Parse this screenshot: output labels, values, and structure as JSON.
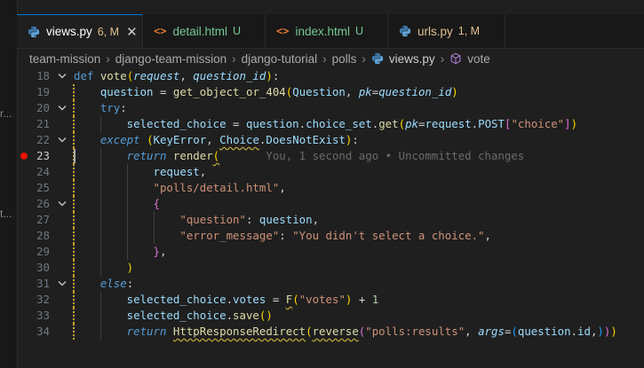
{
  "sidebar_fragments": [
    "r...",
    "t..."
  ],
  "tabs": [
    {
      "name": "views.py",
      "status": "6, M",
      "icon": "python-icon",
      "active": true,
      "status_color": "#e2c08d"
    },
    {
      "name": "detail.html",
      "status": "U",
      "icon": "html-icon",
      "active": false,
      "status_color": "#73c991"
    },
    {
      "name": "index.html",
      "status": "U",
      "icon": "html-icon",
      "active": false,
      "status_color": "#73c991"
    },
    {
      "name": "urls.py",
      "status": "1, M",
      "icon": "python-icon",
      "active": false,
      "status_color": "#e2c08d"
    }
  ],
  "tab_close_glyph": "✕",
  "breadcrumb": {
    "items": [
      "team-mission",
      "django-team-mission",
      "django-tutorial",
      "polls",
      "views.py",
      "vote"
    ],
    "separator": "›"
  },
  "editor": {
    "current_line": 23,
    "blame_text": "You, 1 second ago • Uncommitted changes",
    "line_numbers": [
      "18",
      "19",
      "20",
      "21",
      "22",
      "23",
      "24",
      "25",
      "26",
      "27",
      "28",
      "29",
      "30",
      "31",
      "32",
      "33",
      "34"
    ],
    "lines": [
      [
        {
          "t": "def ",
          "c": "kw"
        },
        {
          "t": "vote",
          "c": "fn"
        },
        {
          "t": "(",
          "c": "br1"
        },
        {
          "t": "request",
          "c": "vi"
        },
        {
          "t": ", ",
          "c": "pu"
        },
        {
          "t": "question_id",
          "c": "vi"
        },
        {
          "t": ")",
          "c": "br1"
        },
        {
          "t": ":",
          "c": "pu"
        }
      ],
      [
        {
          "t": "    question",
          "c": "va"
        },
        {
          "t": " = ",
          "c": "pu"
        },
        {
          "t": "get_object_or_404",
          "c": "fn"
        },
        {
          "t": "(",
          "c": "br1"
        },
        {
          "t": "Question",
          "c": "va"
        },
        {
          "t": ", ",
          "c": "pu"
        },
        {
          "t": "pk",
          "c": "vi"
        },
        {
          "t": "=",
          "c": "pu"
        },
        {
          "t": "question_id",
          "c": "vi"
        },
        {
          "t": ")",
          "c": "br1"
        }
      ],
      [
        {
          "t": "    try",
          "c": "kw"
        },
        {
          "t": ":",
          "c": "pu"
        }
      ],
      [
        {
          "t": "        selected_choice",
          "c": "va"
        },
        {
          "t": " = ",
          "c": "pu"
        },
        {
          "t": "question",
          "c": "va"
        },
        {
          "t": ".",
          "c": "pu"
        },
        {
          "t": "choice_set",
          "c": "va"
        },
        {
          "t": ".",
          "c": "pu"
        },
        {
          "t": "get",
          "c": "fn"
        },
        {
          "t": "(",
          "c": "br1"
        },
        {
          "t": "pk",
          "c": "vi"
        },
        {
          "t": "=",
          "c": "pu"
        },
        {
          "t": "request",
          "c": "va"
        },
        {
          "t": ".",
          "c": "pu"
        },
        {
          "t": "POST",
          "c": "va"
        },
        {
          "t": "[",
          "c": "br2"
        },
        {
          "t": "\"choice\"",
          "c": "st"
        },
        {
          "t": "]",
          "c": "br2"
        },
        {
          "t": ")",
          "c": "br1"
        }
      ],
      [
        {
          "t": "    except",
          "c": "kw-i"
        },
        {
          "t": " ",
          "c": "pu"
        },
        {
          "t": "(",
          "c": "br1"
        },
        {
          "t": "KeyError",
          "c": "va"
        },
        {
          "t": ", ",
          "c": "pu"
        },
        {
          "t": "Choice",
          "c": "va squig"
        },
        {
          "t": ".",
          "c": "pu"
        },
        {
          "t": "DoesNotExist",
          "c": "va"
        },
        {
          "t": ")",
          "c": "br1"
        },
        {
          "t": ":",
          "c": "pu"
        }
      ],
      [
        {
          "t": "        return",
          "c": "kw-i"
        },
        {
          "t": " ",
          "c": "pu"
        },
        {
          "t": "render",
          "c": "fn"
        },
        {
          "t": "(",
          "c": "br1 squig"
        }
      ],
      [
        {
          "t": "            request",
          "c": "va"
        },
        {
          "t": ",",
          "c": "pu"
        }
      ],
      [
        {
          "t": "            \"polls/detail.html\"",
          "c": "st"
        },
        {
          "t": ",",
          "c": "pu"
        }
      ],
      [
        {
          "t": "            {",
          "c": "br2"
        }
      ],
      [
        {
          "t": "                \"question\"",
          "c": "st"
        },
        {
          "t": ": ",
          "c": "pu"
        },
        {
          "t": "question",
          "c": "va"
        },
        {
          "t": ",",
          "c": "pu"
        }
      ],
      [
        {
          "t": "                \"error_message\"",
          "c": "st"
        },
        {
          "t": ": ",
          "c": "pu"
        },
        {
          "t": "\"You didn't select a choice.\"",
          "c": "st"
        },
        {
          "t": ",",
          "c": "pu"
        }
      ],
      [
        {
          "t": "            }",
          "c": "br2"
        },
        {
          "t": ",",
          "c": "pu"
        }
      ],
      [
        {
          "t": "        )",
          "c": "br1"
        }
      ],
      [
        {
          "t": "    else",
          "c": "kw-i"
        },
        {
          "t": ":",
          "c": "pu"
        }
      ],
      [
        {
          "t": "        selected_choice",
          "c": "va"
        },
        {
          "t": ".",
          "c": "pu"
        },
        {
          "t": "votes",
          "c": "va"
        },
        {
          "t": " = ",
          "c": "pu"
        },
        {
          "t": "F",
          "c": "fn squig"
        },
        {
          "t": "(",
          "c": "br1"
        },
        {
          "t": "\"votes\"",
          "c": "st"
        },
        {
          "t": ")",
          "c": "br1"
        },
        {
          "t": " + ",
          "c": "pu"
        },
        {
          "t": "1",
          "c": "nu"
        }
      ],
      [
        {
          "t": "        selected_choice",
          "c": "va"
        },
        {
          "t": ".",
          "c": "pu"
        },
        {
          "t": "save",
          "c": "fn"
        },
        {
          "t": "()",
          "c": "br1"
        }
      ],
      [
        {
          "t": "        return",
          "c": "kw-i"
        },
        {
          "t": " ",
          "c": "pu"
        },
        {
          "t": "HttpResponseRedirect",
          "c": "fn squig"
        },
        {
          "t": "(",
          "c": "br1"
        },
        {
          "t": "reverse",
          "c": "fn squig"
        },
        {
          "t": "(",
          "c": "br2"
        },
        {
          "t": "\"polls:results\"",
          "c": "st"
        },
        {
          "t": ", ",
          "c": "pu"
        },
        {
          "t": "args",
          "c": "vi"
        },
        {
          "t": "=",
          "c": "pu"
        },
        {
          "t": "(",
          "c": "br3"
        },
        {
          "t": "question",
          "c": "va"
        },
        {
          "t": ".",
          "c": "pu"
        },
        {
          "t": "id",
          "c": "va"
        },
        {
          "t": ",",
          "c": "pu"
        },
        {
          "t": ")",
          "c": "br3"
        },
        {
          "t": ")",
          "c": "br2"
        },
        {
          "t": ")",
          "c": "br1"
        }
      ]
    ],
    "fold_lines": [
      "18",
      "20",
      "22",
      "26",
      "31"
    ],
    "modified_lines": [
      "19",
      "20",
      "21",
      "22",
      "23",
      "24",
      "25",
      "26",
      "27",
      "28",
      "29",
      "30",
      "31",
      "32",
      "33",
      "34"
    ],
    "breakpoint_line": "23"
  },
  "colors": {
    "accent": "#0078d4",
    "editor_bg": "#1f1f1f",
    "modified_gutter": "#c7a12b",
    "breakpoint": "#e51400"
  }
}
